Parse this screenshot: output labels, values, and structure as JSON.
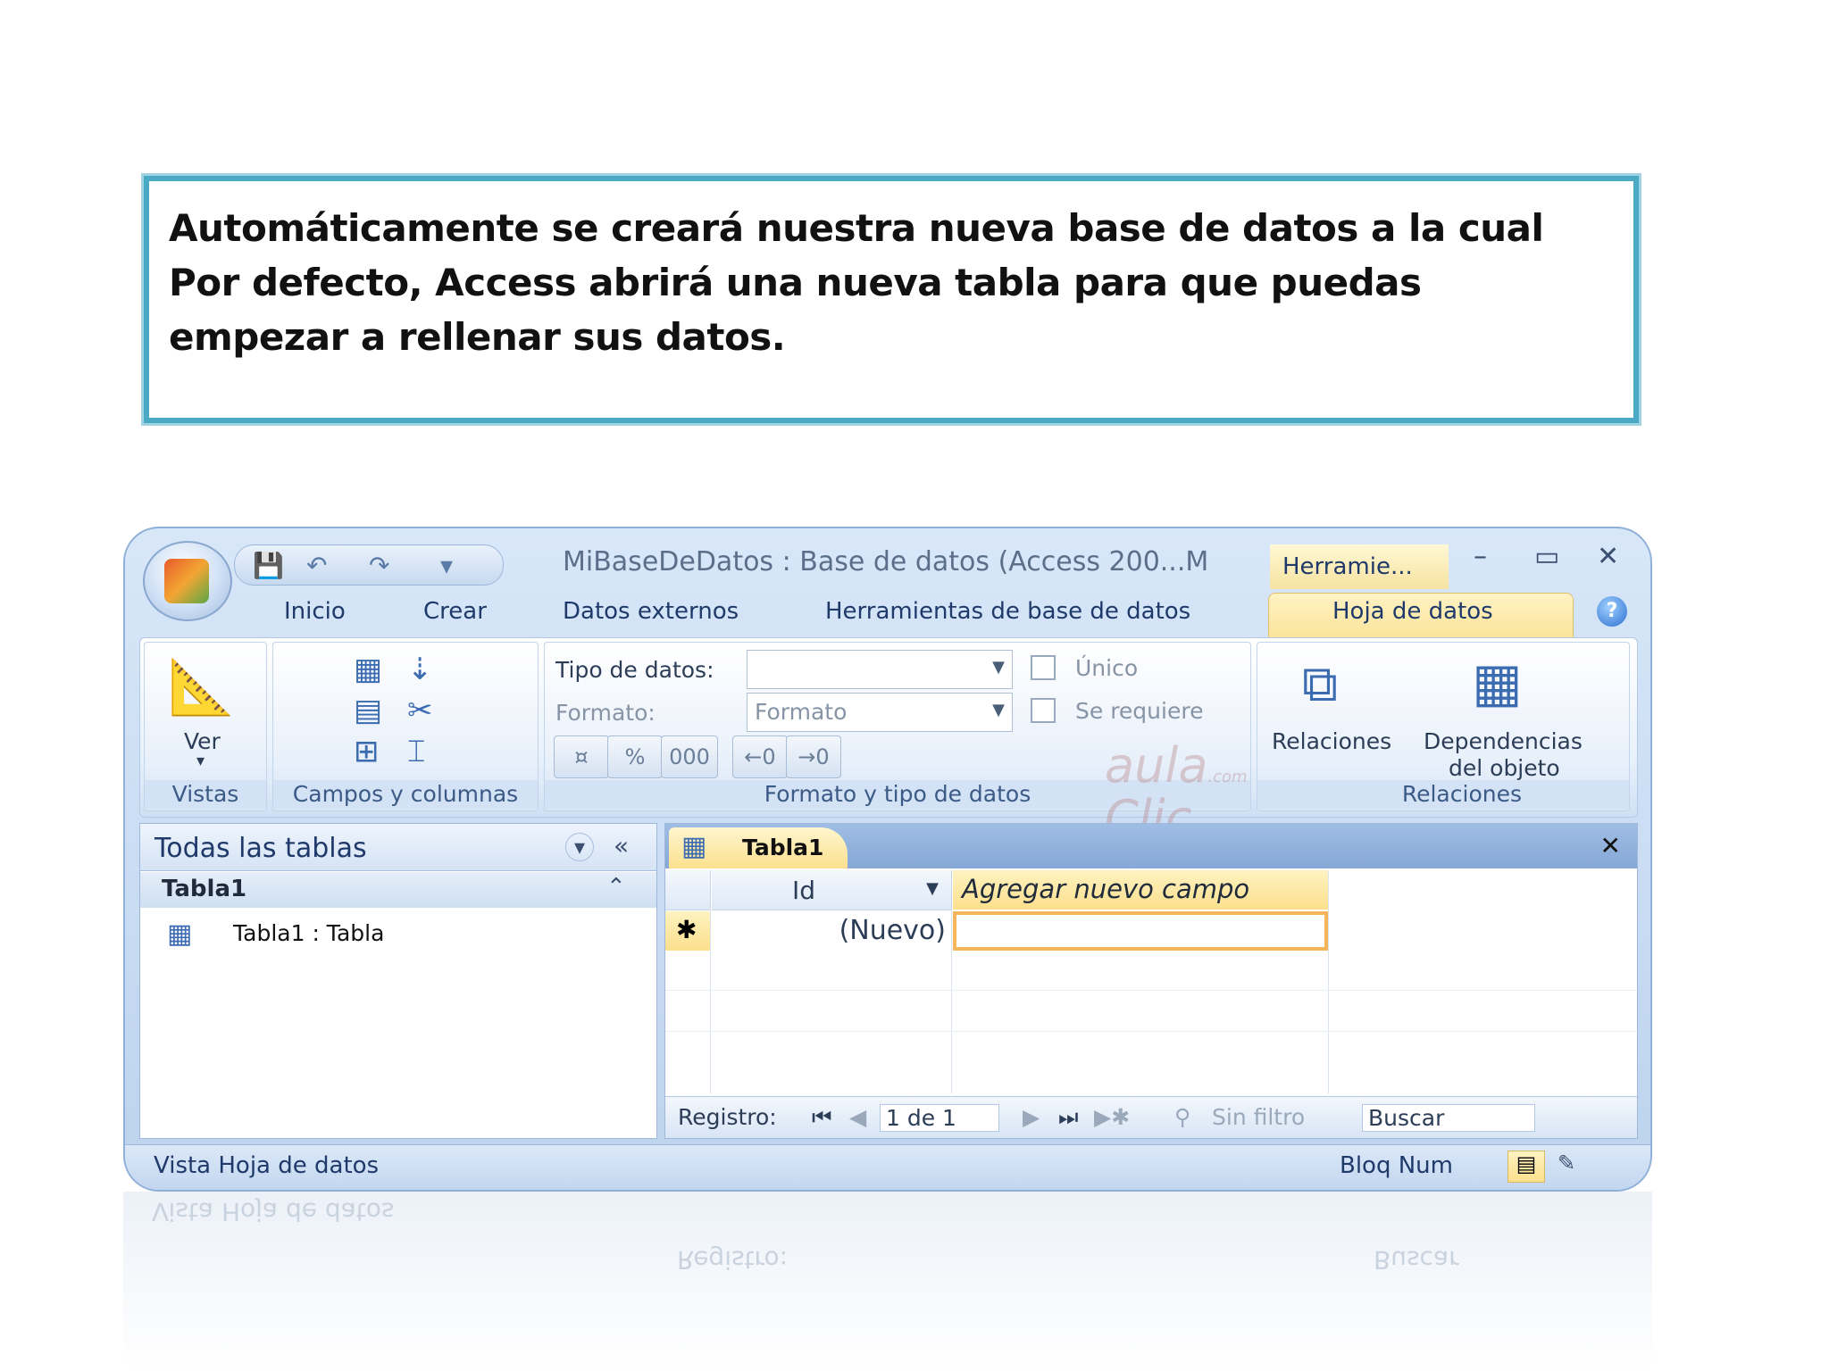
{
  "callout": {
    "line1": "Automáticamente se creará nuestra nueva base de datos a la cual",
    "line2": "Por defecto, Access abrirá una nueva tabla para que puedas",
    "line3": "empezar a rellenar sus datos."
  },
  "window": {
    "title": "MiBaseDeDatos : Base de datos (Access 200...M",
    "contextual_tab": "Herramie...",
    "minimize": "–",
    "maximize": "▭",
    "close": "✕",
    "help": "?"
  },
  "tabs": [
    "Inicio",
    "Crear",
    "Datos externos",
    "Herramientas de base de datos",
    "Hoja de datos"
  ],
  "ribbon": {
    "vistas": {
      "button": "Ver",
      "dropdown": "▾",
      "label": "Vistas"
    },
    "campos": {
      "label": "Campos y columnas"
    },
    "formato": {
      "tipo_label": "Tipo de datos:",
      "formato_label": "Formato:",
      "formato_value": "Formato",
      "unico": "Único",
      "requiere": "Se requiere",
      "pct": "%",
      "thousands": "000",
      "label": "Formato y tipo de datos"
    },
    "relaciones": {
      "rel_button": "Relaciones",
      "dep_line1": "Dependencias",
      "dep_line2": "del objeto",
      "label": "Relaciones"
    }
  },
  "nav_pane": {
    "title": "Todas las tablas",
    "group": "Tabla1",
    "item": "Tabla1 : Tabla"
  },
  "document": {
    "tab": "Tabla1",
    "close": "✕",
    "col_id": "Id",
    "col_new": "Agregar nuevo campo",
    "row_marker": "✱",
    "row_value": "(Nuevo)",
    "record_label": "Registro:",
    "record_pos": "1 de 1",
    "filter": "Sin filtro",
    "search": "Buscar"
  },
  "status": {
    "left": "Vista Hoja de datos",
    "right": "Bloq Num"
  },
  "watermark": {
    "line1": "aula",
    "line2": "Clic",
    "suffix": ".com"
  },
  "reflection": {
    "left": "Vista Hoja de datos",
    "record": "Registro:",
    "search": "Buscar"
  }
}
